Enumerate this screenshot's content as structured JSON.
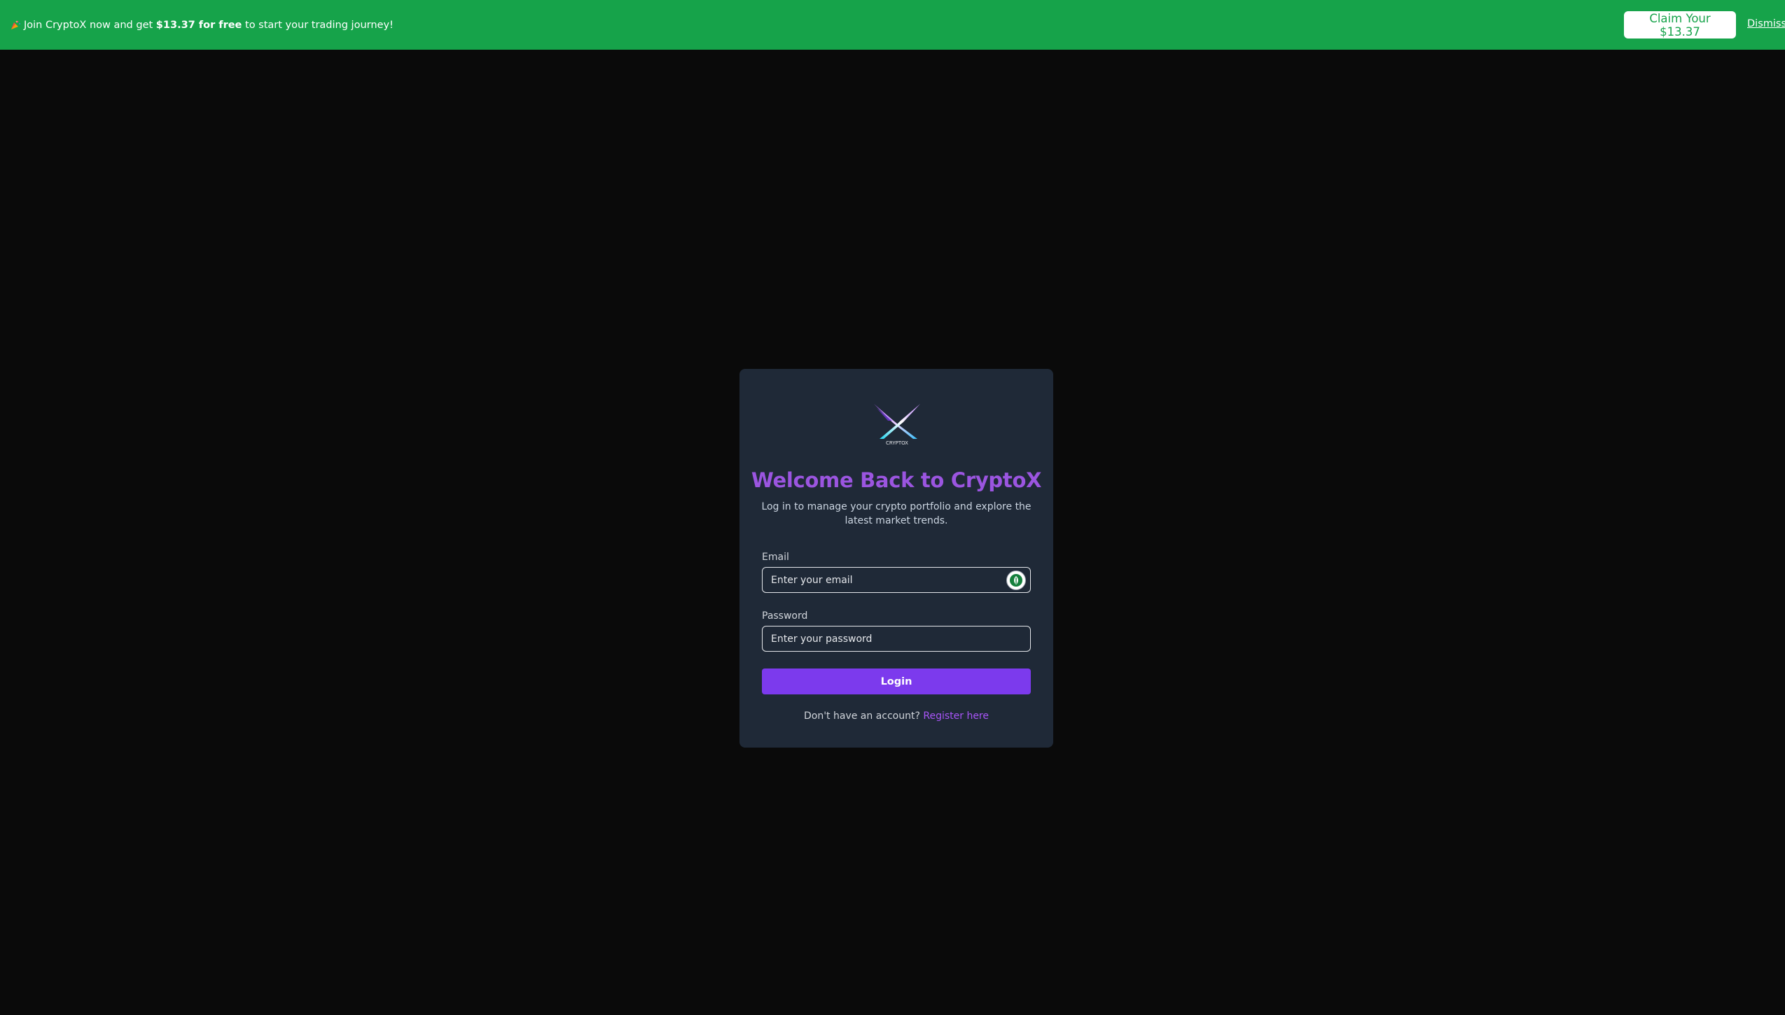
{
  "banner": {
    "emoji_icon": "party-popper-icon",
    "text_before": "Join CryptoX now and get ",
    "text_bold": "$13.37 for free",
    "text_after": " to start your trading journey!",
    "claim_label": "Claim Your $13.37",
    "dismiss_label": "Dismiss",
    "background_color": "#16a34a"
  },
  "login": {
    "logo_icon": "cryptox-logo",
    "logo_text": "CRYPTOX",
    "title": "Welcome Back to CryptoX",
    "subtitle": "Log in to manage your crypto portfolio and explore the latest market trends.",
    "email_label": "Email",
    "email_placeholder": "Enter your email",
    "email_value": "",
    "password_label": "Password",
    "password_placeholder": "Enter your password",
    "password_value": "",
    "login_label": "Login",
    "register_prompt": "Don't have an account?",
    "register_link": "Register here",
    "accent_color": "#7c3aed"
  }
}
